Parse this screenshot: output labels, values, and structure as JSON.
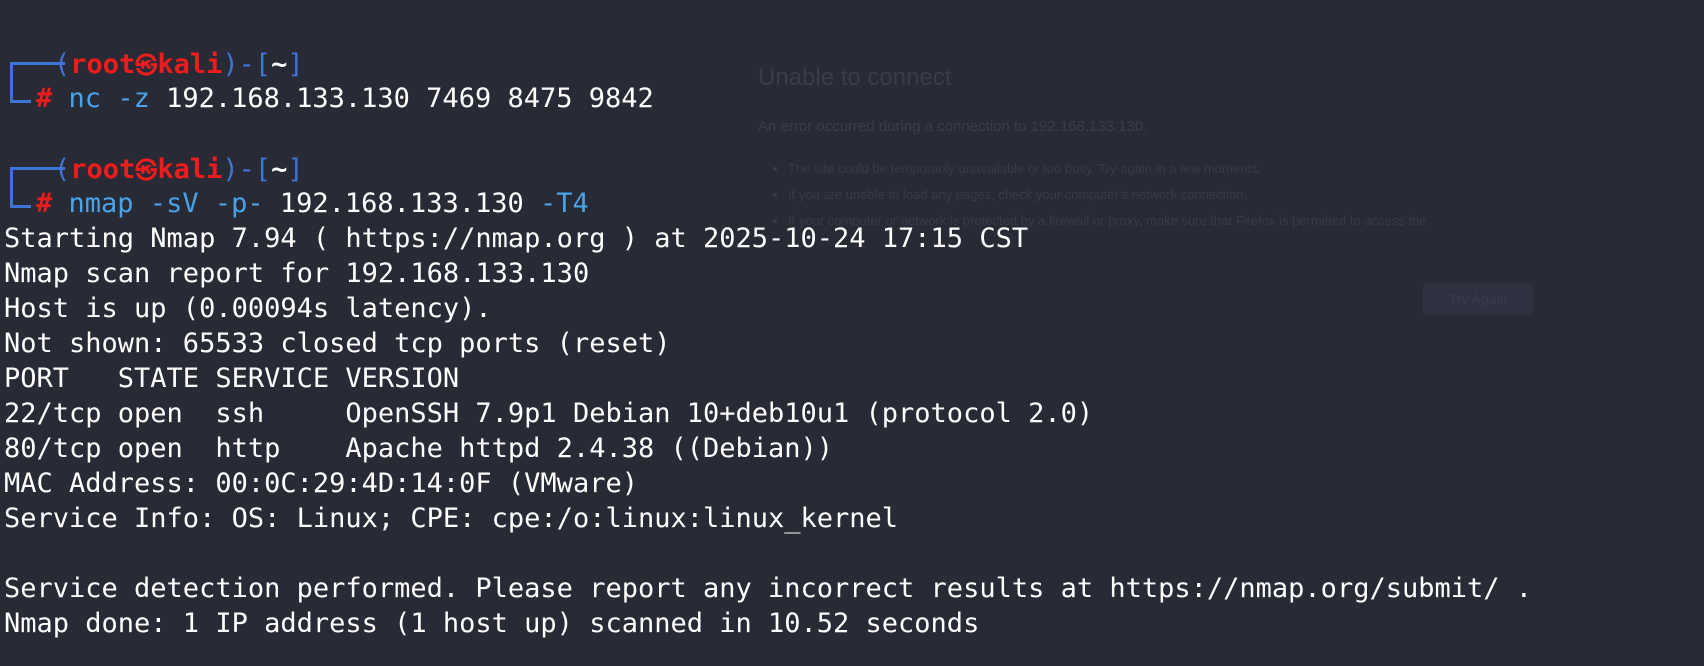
{
  "ghost_page": {
    "title": "Unable to connect",
    "description": "An error occurred during a connection to 192.168.133.130.",
    "bullets": [
      "The site could be temporarily unavailable or too busy. Try again in a few moments.",
      "If you are unable to load any pages, check your computer's network connection.",
      "If your computer or network is protected by a firewall or proxy, make sure that Firefox is permitted to access the"
    ],
    "try_again": "Try Again"
  },
  "prompt": {
    "open": "(",
    "user": "root",
    "at": "㉿",
    "host": "kali",
    "close": ")-[",
    "dir": "~",
    "end": "]",
    "hash": "#"
  },
  "commands": [
    {
      "cmd": "nc",
      "flags": "-z",
      "args": "192.168.133.130 7469 8475 9842",
      "tail": ""
    },
    {
      "cmd": "nmap",
      "flags": "-sV -p-",
      "args": "192.168.133.130",
      "tail": "-T4"
    }
  ],
  "output": [
    "Starting Nmap 7.94 ( https://nmap.org ) at 2025-10-24 17:15 CST",
    "Nmap scan report for 192.168.133.130",
    "Host is up (0.00094s latency).",
    "Not shown: 65533 closed tcp ports (reset)",
    "PORT   STATE SERVICE VERSION",
    "22/tcp open  ssh     OpenSSH 7.9p1 Debian 10+deb10u1 (protocol 2.0)",
    "80/tcp open  http    Apache httpd 2.4.38 ((Debian))",
    "MAC Address: 00:0C:29:4D:14:0F (VMware)",
    "Service Info: OS: Linux; CPE: cpe:/o:linux:linux_kernel",
    "",
    "Service detection performed. Please report any incorrect results at https://nmap.org/submit/ .",
    "Nmap done: 1 IP address (1 host up) scanned in 10.52 seconds"
  ],
  "colors": {
    "background": "#282a36",
    "prompt_blue": "#3d74d6",
    "prompt_red": "#ee1c1c",
    "command_blue": "#4aa3e6",
    "text": "#ffffff"
  }
}
